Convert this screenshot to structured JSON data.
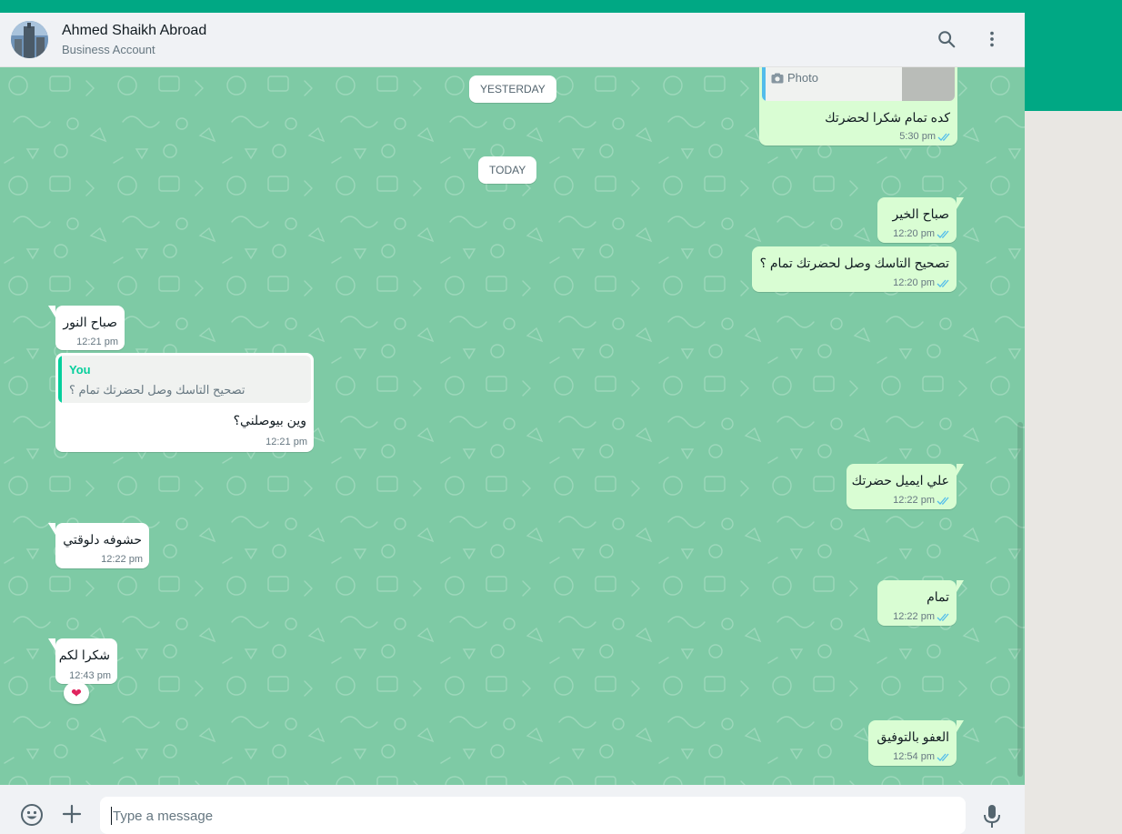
{
  "header": {
    "name": "Ahmed Shaikh Abroad",
    "subtitle": "Business Account"
  },
  "date_chips": {
    "yesterday": "YESTERDAY",
    "today": "TODAY"
  },
  "messages": {
    "m0": {
      "quote_label": "Photo",
      "text": "كده تمام شكرا لحضرتك",
      "time": "5:30 pm"
    },
    "m1": {
      "text": "صباح الخير",
      "time": "12:20 pm"
    },
    "m2": {
      "text": "تصحيح التاسك وصل لحضرتك تمام ؟",
      "time": "12:20 pm"
    },
    "m3": {
      "text": "صباح النور",
      "time": "12:21 pm"
    },
    "m4": {
      "quote_author": "You",
      "quote_text": "تصحيح التاسك وصل لحضرتك تمام ؟",
      "text": "وين بيوصلني؟",
      "time": "12:21 pm"
    },
    "m5": {
      "text": "علي ايميل حضرتك",
      "time": "12:22 pm"
    },
    "m6": {
      "text": "حشوفه دلوقتي",
      "time": "12:22 pm"
    },
    "m7": {
      "text": "تمام",
      "time": "12:22 pm"
    },
    "m8": {
      "text": "شكرا لكم",
      "time": "12:43 pm",
      "reaction": "❤"
    },
    "m9": {
      "text": "العفو بالتوفيق",
      "time": "12:54 pm"
    }
  },
  "composer": {
    "placeholder": "Type a message"
  },
  "colors": {
    "brand": "#00a884",
    "chat_bg": "#7ecaa5",
    "outgoing": "#d9fdd3",
    "incoming": "#ffffff",
    "read_tick": "#53bdeb"
  }
}
